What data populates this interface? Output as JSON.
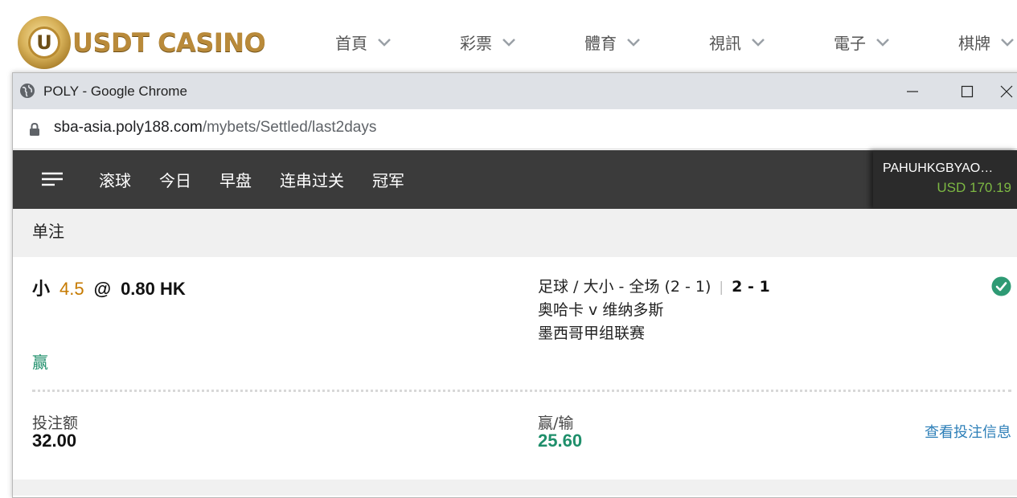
{
  "site": {
    "logo_mark": "U",
    "logo_text": "USDT CASINO",
    "nav": [
      "首頁",
      "彩票",
      "體育",
      "視訊",
      "電子",
      "棋牌"
    ]
  },
  "browser": {
    "title": "POLY - Google Chrome",
    "url_host": "sba-asia.poly188.com",
    "url_path": "/mybets/Settled/last2days"
  },
  "app": {
    "tabs": [
      "滚球",
      "今日",
      "早盘",
      "连串过关",
      "冠军"
    ],
    "account": {
      "name": "PAHUHKGBYAO…",
      "balance": "USD 170.19"
    },
    "section_label": "单注"
  },
  "bet": {
    "selection": "小",
    "handicap": "4.5",
    "at": "@",
    "odds": "0.80 HK",
    "market": "足球 / 大小 - 全场 (2 - 1)",
    "separator": "|",
    "score": "2 - 1",
    "match": "奥哈卡 v 维纳多斯",
    "league": "墨西哥甲组联赛",
    "result": "赢",
    "stake_label": "投注额",
    "stake": "32.00",
    "winloss_label": "赢/输",
    "winloss": "25.60",
    "detail_link": "查看投注信息"
  },
  "colors": {
    "nav_bg": "#3b3b3b",
    "balance": "#7db843",
    "win": "#1f8f6b",
    "handicap": "#c67a00",
    "link": "#2d7fb8"
  }
}
